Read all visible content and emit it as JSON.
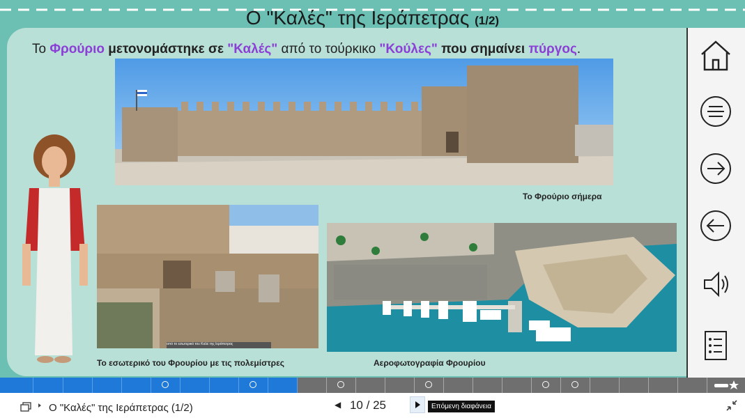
{
  "slide": {
    "title_main": "Ο \"Καλές\" της Ιεράπετρας",
    "title_suffix": "(1/2)",
    "intro": {
      "p1": "Το ",
      "p2": "Φρούριο",
      "p3": " μετονομάστηκε σε ",
      "p4": "\"Καλές\"",
      "p5": " από το τούρκικο ",
      "p6": "\"Κούλες\"",
      "p7": " που σημαίνει ",
      "p8": "πύργος",
      "p9": "."
    },
    "captions": {
      "fortress_today": "Το Φρούριο σήμερα",
      "interior": "Το εσωτερικό του Φρουρίου με τις πολεμίστρες",
      "aerial": "Αεροφωτογραφία Φρουρίου",
      "photo_credit": "από το εσωτερικό του Καλέ της Ιεράπετρας"
    },
    "accent_color": "#8b3fd6",
    "teal_bg": "#6bbfb3"
  },
  "sidebar": {
    "icons": [
      "home-icon",
      "menu-icon",
      "next-icon",
      "previous-icon",
      "audio-icon",
      "list-icon"
    ]
  },
  "progress": {
    "current": 10,
    "total": 25
  },
  "footer": {
    "slide_title": "Ο \"Καλές\" της Ιεράπετρας (1/2)",
    "current_page": "10",
    "separator": "/",
    "total_pages": "25",
    "next_tooltip": "Επόμενη διαφάνεια"
  }
}
